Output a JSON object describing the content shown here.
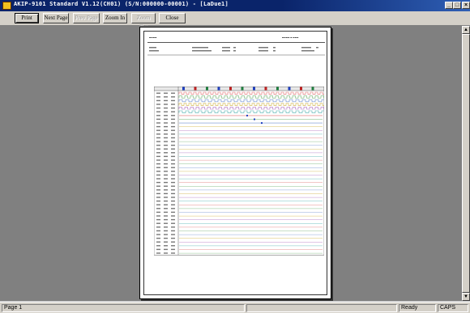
{
  "window": {
    "title": "AKIP-9101 Standard V1.12(CH01) (S/N:000000-00001) - [LaDue1]",
    "controls": {
      "minimize": "_",
      "maximize": "□",
      "close": "×"
    }
  },
  "toolbar": {
    "print": "Print",
    "next_page": "Next Page",
    "prev_page": "Prev Page",
    "zoom_in": "Zoom In",
    "zoom_out": "Zoom Out",
    "close": "Close"
  },
  "status": {
    "page": "Page 1",
    "mode": "Ready",
    "indicator": "CAPS"
  },
  "colors": {
    "titlebar": "#0a246a",
    "workspace": "#808080",
    "chrome": "#d4d0c8",
    "paper": "#ffffff"
  },
  "icons": {
    "app": "app-icon",
    "scroll_up": "up-arrow-icon",
    "scroll_down": "down-arrow-icon"
  }
}
